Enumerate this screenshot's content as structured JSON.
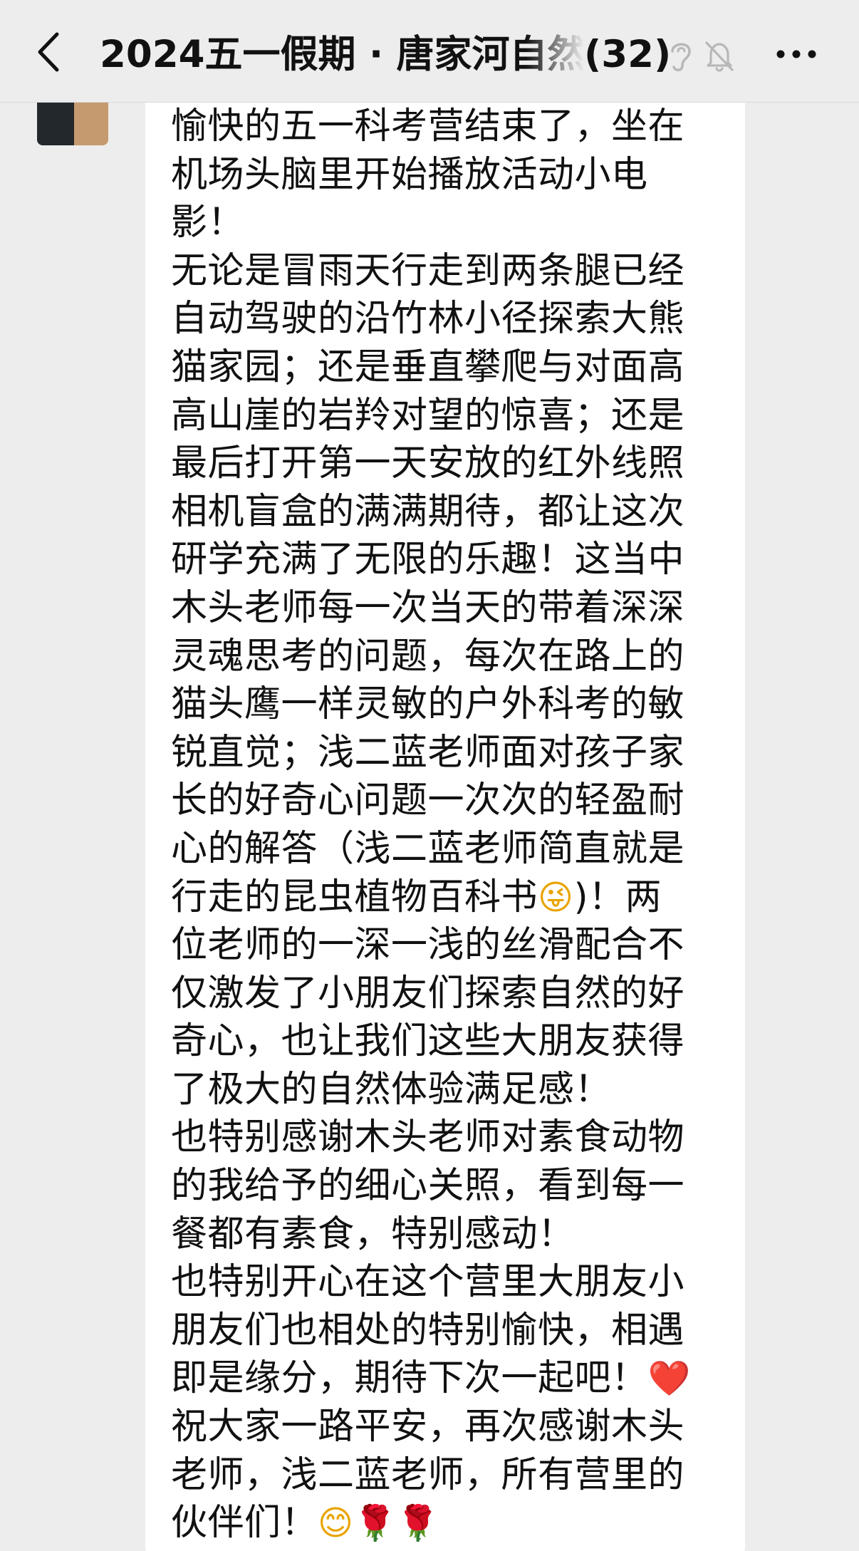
{
  "header": {
    "title": "2024五一假期 · 唐家河自然",
    "member_count": "(32)",
    "icons": {
      "back": "chevron-left-icon",
      "ear": "ear-icon",
      "mute": "bell-muted-icon",
      "more": "more-dots-icon"
    }
  },
  "message": {
    "lines": [
      "愉快的五一科考营结束了，坐在",
      "机场头脑里开始播放活动小电",
      "影！",
      "无论是冒雨天行走到两条腿已经",
      "自动驾驶的沿竹林小径探索大熊",
      "猫家园；还是垂直攀爬与对面高",
      "高山崖的岩羚对望的惊喜；还是",
      "最后打开第一天安放的红外线照",
      "相机盲盒的满满期待，都让这次",
      "研学充满了无限的乐趣！这当中",
      "木头老师每一次当天的带着深深",
      "灵魂思考的问题，每次在路上的",
      "猫头鹰一样灵敏的户外科考的敏",
      "锐直觉；浅二蓝老师面对孩子家",
      "长的好奇心问题一次次的轻盈耐",
      "心的解答（浅二蓝老师简直就是",
      "行走的昆虫植物百科书",
      ")！两",
      "位老师的一深一浅的丝滑配合不",
      "仅激发了小朋友们探索自然的好",
      "奇心，也让我们这些大朋友获得",
      "了极大的自然体验满足感！",
      "也特别感谢木头老师对素食动物",
      "的我给予的细心关照，看到每一",
      "餐都有素食，特别感动！",
      "也特别开心在这个营里大朋友小",
      "朋友们也相处的特别愉快，相遇",
      "即是缘分，期待下次一起吧！",
      "祝大家一路平安，再次感谢木头",
      "老师，浅二蓝老师，所有营里的",
      "伙伴们！"
    ],
    "emojis": {
      "wink": "😜",
      "heart": "❤️",
      "smile": "😊",
      "rose": "🌹"
    }
  },
  "colors": {
    "background": "#ededed",
    "bubble": "#ffffff",
    "text": "#111111"
  }
}
